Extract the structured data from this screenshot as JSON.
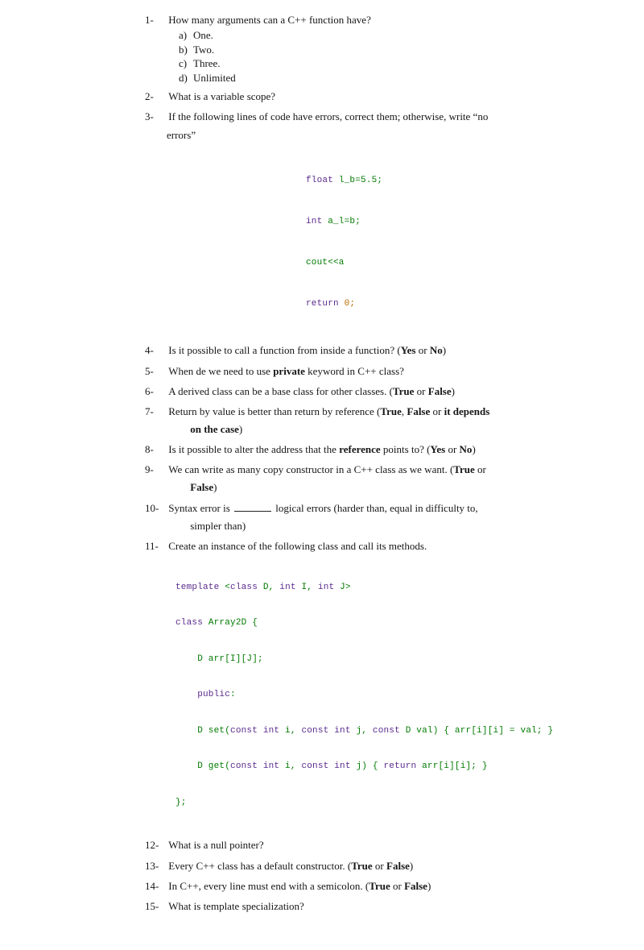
{
  "q1": {
    "num": "1-",
    "text": "How many arguments can a C++ function have?",
    "a_l": "a)",
    "a": "One.",
    "b_l": "b)",
    "b": "Two.",
    "c_l": "c)",
    "c": "Three.",
    "d_l": "d)",
    "d": "Unlimited"
  },
  "q2": {
    "num": "2-",
    "text": "What is a variable scope?"
  },
  "q3": {
    "num": "3-",
    "text_a": "If the following lines of code have errors, correct them; otherwise, write “no",
    "text_b": "errors”",
    "code1": "float",
    "code1b": " l_b=5.5;",
    "code2": "int",
    "code2b": " a_l=b;",
    "code3": "cout<<a",
    "code4": "return",
    "code4b": " 0;"
  },
  "q4": {
    "num": "4-",
    "text_a": "Is it possible to call a function from inside a function? (",
    "yn": "Yes",
    "or": " or ",
    "no": "No",
    "cl": ")"
  },
  "q5": {
    "num": "5-",
    "text_a": "When de we need to use ",
    "kw": "private",
    "text_b": " keyword in C++ class?"
  },
  "q6": {
    "num": "6-",
    "text_a": "A derived class can be a base class for other classes. (",
    "t": "True",
    "or": " or ",
    "f": "False",
    "cl": ")"
  },
  "q7": {
    "num": "7-",
    "text_a": "Return by value is better than return by reference (",
    "t": "True",
    ", ": ", ",
    "f": "False",
    "or": " or ",
    "dep": "it depends",
    "nl": "on the case",
    "cl": ")"
  },
  "q8": {
    "num": "8-",
    "text_a": "Is it possible to alter the address that the ",
    "kw": "reference",
    "text_b": " points to? (",
    "y": "Yes",
    "or": " or ",
    "n": "No",
    "cl": ")"
  },
  "q9": {
    "num": "9-",
    "text_a": "We can write as many copy constructor in a C++ class as we want. (",
    "t": "True",
    "or": " or",
    "nl": "False",
    "cl": ")"
  },
  "q10": {
    "num": "10-",
    "text_a": "Syntax error is ",
    "text_b": " logical errors (harder than, equal in difficulty to,",
    "nl": "simpler than)"
  },
  "q11": {
    "num": "11-",
    "text": "Create an instance of the following class and call its methods.",
    "c": {
      "l1a": "template",
      "l1b": " <",
      "l1c": "class",
      "l1d": " D, ",
      "l1e": "int",
      "l1f": " I, ",
      "l1g": "int",
      "l1h": " J>",
      "l2a": "class",
      "l2b": " Array2D {",
      "l3": "    D arr[I][J];",
      "l4a": "    public",
      "l4b": ":",
      "l5a": "    D set(",
      "l5b": "const int",
      "l5c": " i, ",
      "l5d": "const int",
      "l5e": " j, ",
      "l5f": "const",
      "l5g": " D val) { arr[i][i] = val; }",
      "l6a": "    D get(",
      "l6b": "const int",
      "l6c": " i, ",
      "l6d": "const int",
      "l6e": " j) { ",
      "l6f": "return",
      "l6g": " arr[i][i]; }",
      "l7": "};"
    }
  },
  "q12": {
    "num": "12-",
    "text": "What is a null pointer?"
  },
  "q13": {
    "num": "13-",
    "text_a": "Every C++ class has a default constructor. (",
    "t": "True",
    "or": " or ",
    "f": "False",
    "cl": ")"
  },
  "q14": {
    "num": "14-",
    "text_a": "In C++, every line must end with a semicolon. (",
    "t": "True",
    "or": " or ",
    "f": "False",
    "cl": ")"
  },
  "q15": {
    "num": "15-",
    "text": "What is template specialization?"
  }
}
